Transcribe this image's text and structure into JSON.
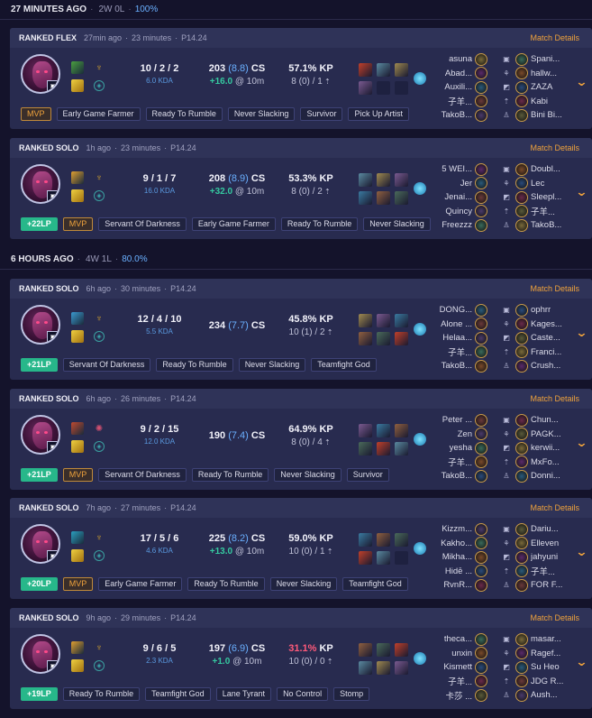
{
  "groups": [
    {
      "time": "27 MINUTES AGO",
      "record": "2W 0L",
      "winrate": "100%"
    },
    {
      "time": "6 HOURS AGO",
      "record": "4W 1L",
      "winrate": "80.0%"
    }
  ],
  "match_details_label": "Match Details",
  "matches": [
    {
      "queue": "RANKED FLEX",
      "ago": "27min ago",
      "duration": "23 minutes",
      "patch": "P14.24",
      "kda": "10 / 2 / 2",
      "kda_ratio": "6.0 KDA",
      "cs": "203",
      "cs_pm": "(8.8)",
      "cs_label": "CS",
      "cs_diff": "+16.0",
      "cs_diff_suffix": "@ 10m",
      "kp": "57.1% KP",
      "kp_low": false,
      "kp_sub": "8 (0) / 1",
      "lp": "",
      "tags": [
        "MVP",
        "Early Game Farmer",
        "Ready To Rumble",
        "Never Slacking",
        "Survivor",
        "Pick Up Artist"
      ],
      "blue": [
        "asuna",
        "Abad...",
        "Auxili...",
        "子羊...",
        "TakoB..."
      ],
      "red": [
        "Spani...",
        "hallw...",
        "ZAZA",
        "Kabi",
        "Bini Bi..."
      ]
    },
    {
      "queue": "RANKED SOLO",
      "ago": "1h ago",
      "duration": "23 minutes",
      "patch": "P14.24",
      "kda": "9 / 1 / 7",
      "kda_ratio": "16.0 KDA",
      "cs": "208",
      "cs_pm": "(8.9)",
      "cs_label": "CS",
      "cs_diff": "+32.0",
      "cs_diff_suffix": "@ 10m",
      "kp": "53.3% KP",
      "kp_low": false,
      "kp_sub": "8 (0) / 2",
      "lp": "+22LP",
      "tags": [
        "MVP",
        "Servant Of Darkness",
        "Early Game Farmer",
        "Ready To Rumble",
        "Never Slacking"
      ],
      "blue": [
        "5 WEI...",
        "Jer",
        "Jenai...",
        "Quincy",
        "Freezzz"
      ],
      "red": [
        "Doubl...",
        "Lec",
        "Sleepl...",
        "子羊...",
        "TakoB..."
      ]
    },
    {
      "queue": "RANKED SOLO",
      "ago": "6h ago",
      "duration": "30 minutes",
      "patch": "P14.24",
      "kda": "12 / 4 / 10",
      "kda_ratio": "5.5 KDA",
      "cs": "234",
      "cs_pm": "(7.7)",
      "cs_label": "CS",
      "cs_diff": "",
      "cs_diff_suffix": "",
      "kp": "45.8% KP",
      "kp_low": false,
      "kp_sub": "10 (1) / 2",
      "lp": "+21LP",
      "tags": [
        "Servant Of Darkness",
        "Ready To Rumble",
        "Never Slacking",
        "Teamfight God"
      ],
      "blue": [
        "DONG...",
        "Alone ...",
        "Helaa...",
        "子羊...",
        "TakoB..."
      ],
      "red": [
        "ophrr",
        "Kages...",
        "Caste...",
        "Franci...",
        "Crush..."
      ]
    },
    {
      "queue": "RANKED SOLO",
      "ago": "6h ago",
      "duration": "26 minutes",
      "patch": "P14.24",
      "kda": "9 / 2 / 15",
      "kda_ratio": "12.0 KDA",
      "cs": "190",
      "cs_pm": "(7.4)",
      "cs_label": "CS",
      "cs_diff": "",
      "cs_diff_suffix": "",
      "kp": "64.9% KP",
      "kp_low": false,
      "kp_sub": "8 (0) / 4",
      "lp": "+21LP",
      "tags": [
        "MVP",
        "Servant Of Darkness",
        "Ready To Rumble",
        "Never Slacking",
        "Survivor"
      ],
      "blue": [
        "Peter ...",
        "Zen",
        "yesha",
        "子羊...",
        "TakoB..."
      ],
      "red": [
        "Chun...",
        "PAGK...",
        "kerwii...",
        "MxFo...",
        "Donni..."
      ]
    },
    {
      "queue": "RANKED SOLO",
      "ago": "7h ago",
      "duration": "27 minutes",
      "patch": "P14.24",
      "kda": "17 / 5 / 6",
      "kda_ratio": "4.6 KDA",
      "cs": "225",
      "cs_pm": "(8.2)",
      "cs_label": "CS",
      "cs_diff": "+13.0",
      "cs_diff_suffix": "@ 10m",
      "kp": "59.0% KP",
      "kp_low": false,
      "kp_sub": "10 (0) / 1",
      "lp": "+20LP",
      "tags": [
        "MVP",
        "Early Game Farmer",
        "Ready To Rumble",
        "Never Slacking",
        "Teamfight God"
      ],
      "blue": [
        "Kizzm...",
        "Kakhо...",
        "Mikha...",
        "Hidē ...",
        "RvnR..."
      ],
      "red": [
        "Dariu...",
        "Elleven",
        "jahyuni",
        "子羊...",
        "FOR F..."
      ]
    },
    {
      "queue": "RANKED SOLO",
      "ago": "9h ago",
      "duration": "29 minutes",
      "patch": "P14.24",
      "kda": "9 / 6 / 5",
      "kda_ratio": "2.3 KDA",
      "cs": "197",
      "cs_pm": "(6.9)",
      "cs_label": "CS",
      "cs_diff": "+1.0",
      "cs_diff_suffix": "@ 10m",
      "kp": "31.1%",
      "kp_tail": " KP",
      "kp_low": true,
      "kp_sub": "10 (0) / 0",
      "lp": "+19LP",
      "tags": [
        "Ready To Rumble",
        "Teamfight God",
        "Lane Tyrant",
        "No Control",
        "Stomp"
      ],
      "blue": [
        "theca...",
        "unxin",
        "Kismett",
        "子羊...",
        "卡莎 ..."
      ],
      "red": [
        "masar...",
        "Ragef...",
        "Su Heo",
        "JDG R...",
        "Aush..."
      ]
    }
  ],
  "colors": {
    "accent": "#f0a33c",
    "lp": "#27b78a",
    "kda": "#5a9ae0",
    "good": "#35c9a0",
    "low_kp": "#ff5a7a",
    "card": "#282b4f",
    "bg": "#14132b"
  }
}
